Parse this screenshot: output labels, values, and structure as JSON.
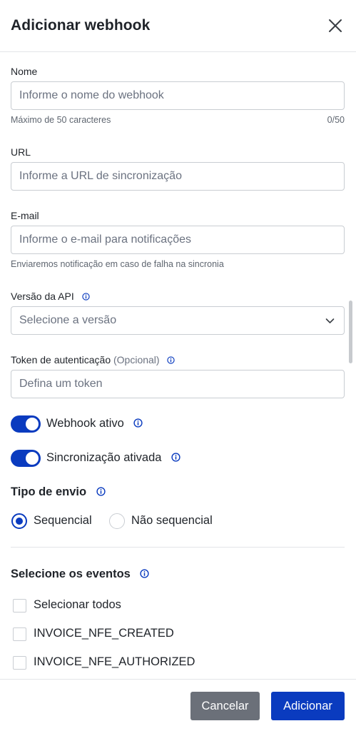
{
  "modal": {
    "title": "Adicionar webhook"
  },
  "fields": {
    "name": {
      "label": "Nome",
      "placeholder": "Informe o nome do webhook",
      "value": "",
      "help": "Máximo de 50 caracteres",
      "counter": "0/50"
    },
    "url": {
      "label": "URL",
      "placeholder": "Informe a URL de sincronização",
      "value": ""
    },
    "email": {
      "label": "E-mail",
      "placeholder": "Informe o e-mail para notificações",
      "value": "",
      "help": "Enviaremos notificação em caso de falha na sincronia"
    },
    "api_version": {
      "label": "Versão da API",
      "placeholder": "Selecione a versão"
    },
    "token": {
      "label": "Token de autenticação",
      "optional": "(Opcional)",
      "placeholder": "Defina um token",
      "value": ""
    }
  },
  "toggles": {
    "webhook_active": {
      "label": "Webhook ativo",
      "on": true
    },
    "sync_enabled": {
      "label": "Sincronização ativada",
      "on": true
    }
  },
  "send_type": {
    "title": "Tipo de envio",
    "options": [
      "Sequencial",
      "Não sequencial"
    ],
    "selected": "Sequencial"
  },
  "events": {
    "title": "Selecione os eventos",
    "select_all": "Selecionar todos",
    "items": [
      "INVOICE_NFE_CREATED",
      "INVOICE_NFE_AUTHORIZED"
    ]
  },
  "footer": {
    "cancel_label": "Cancelar",
    "add_label": "Adicionar"
  },
  "colors": {
    "primary": "#0a3bbf",
    "secondary_button": "#6b7079",
    "border": "#c9cdd2",
    "divider": "#e3e5e8"
  },
  "icons": {
    "close": "close-icon",
    "info": "info-icon",
    "chevron": "chevron-down-icon"
  }
}
